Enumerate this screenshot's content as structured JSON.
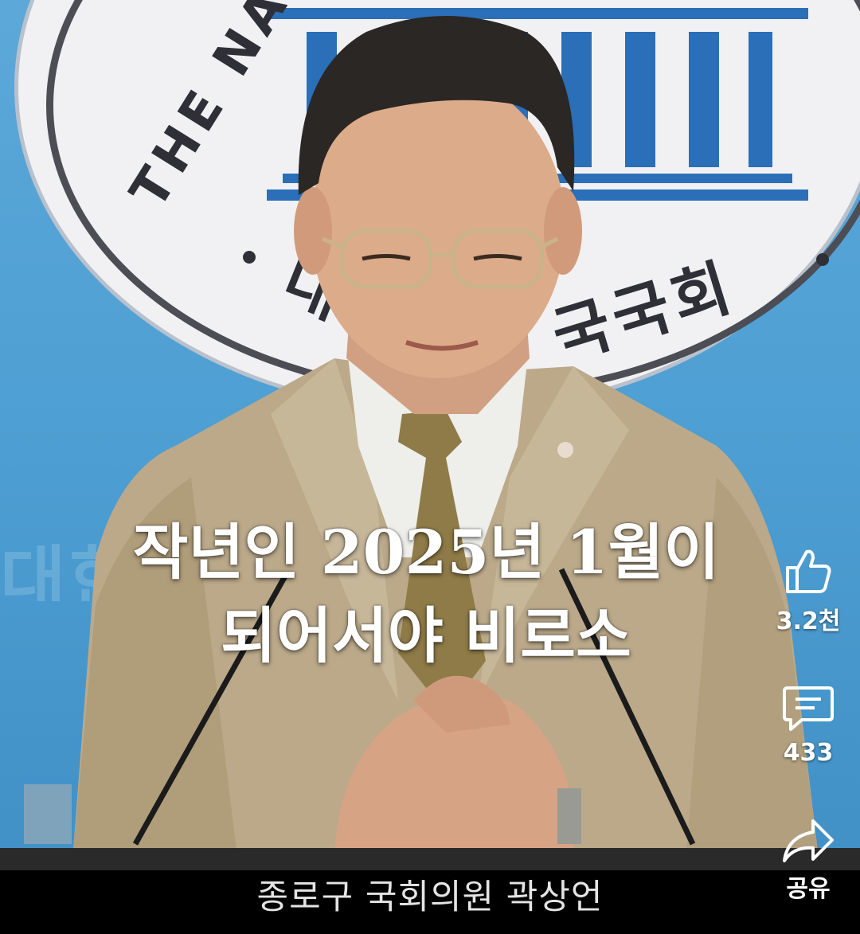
{
  "emblem": {
    "english_text": "THE NATIO",
    "korean_text_right": "국국회",
    "korean_text_left": "대"
  },
  "captions": {
    "line1": "작년인 2025년 1월이",
    "line2": "되어서야 비로소",
    "bottom": "종로구 국회의원 곽상언"
  },
  "actions": {
    "like": {
      "icon": "thumbs-up-icon",
      "count": "3.2천"
    },
    "comment": {
      "icon": "comment-icon",
      "count": "433"
    },
    "share": {
      "icon": "share-icon",
      "label": "공유"
    }
  },
  "colors": {
    "background_blue": "#4e9fd3",
    "emblem_white": "#f1f1f3",
    "emblem_blue": "#2a6fb8",
    "suit_beige": "#bcac8c",
    "caption_text": "#ffffff"
  }
}
